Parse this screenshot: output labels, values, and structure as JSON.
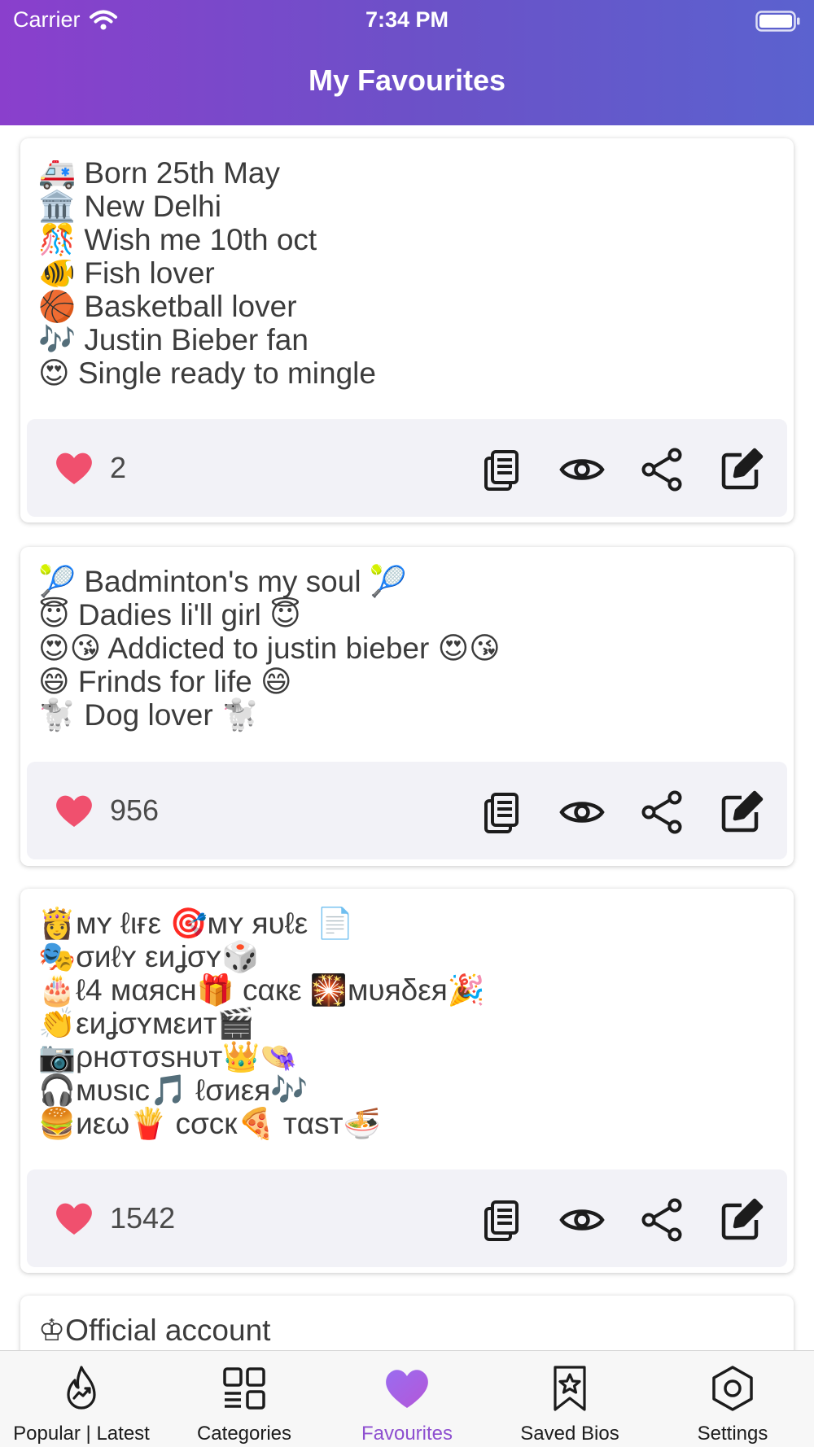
{
  "status_bar": {
    "carrier": "Carrier",
    "time": "7:34 PM"
  },
  "header": {
    "title": "My Favourites"
  },
  "cards": [
    {
      "text": "🚑 Born 25th May\n🏛️ New Delhi\n🎊 Wish me 10th oct\n🐠 Fish lover\n🏀 Basketball lover\n🎶 Justin Bieber fan\n😍 Single ready to mingle",
      "likes": "2"
    },
    {
      "text": "🎾 Badminton's my soul 🎾\n😇 Dadies li'll girl 😇\n😍😘 Addicted to justin bieber 😍😘\n😄 Frinds for life 😄\n🐩 Dog lover 🐩",
      "likes": "956"
    },
    {
      "text": "👸ᴍʏ ℓιғε 🎯ᴍʏ яυℓε 📄\n🎭σиℓʏ εиʝσʏ🎲\n🎂ℓ4 мαяcн🎁 cαкε 🎇мυяδεя🎉\n👏εиʝσʏмεит🎬\n📷ρнσтσѕнυт👑👒\n🎧мυѕιc🎵 ℓσиεя🎶\n🍔иεω🍟 cσcк🍕 тαѕт🍜",
      "likes": "1542"
    },
    {
      "text": "♔Official account",
      "likes": ""
    }
  ],
  "tabs": [
    {
      "label": "Popular | Latest",
      "icon": "flame-icon",
      "active": false
    },
    {
      "label": "Categories",
      "icon": "grid-icon",
      "active": false
    },
    {
      "label": "Favourites",
      "icon": "heart-icon",
      "active": true
    },
    {
      "label": "Saved Bios",
      "icon": "bookmark-star-icon",
      "active": false
    },
    {
      "label": "Settings",
      "icon": "hexagon-gear-icon",
      "active": false
    }
  ],
  "colors": {
    "header_gradient_start": "#8a3fcc",
    "header_gradient_end": "#5b62cf",
    "like_heart": "#f0506e",
    "active_tab": "#8e4fd0",
    "action_bar_bg": "#f2f2f7"
  }
}
